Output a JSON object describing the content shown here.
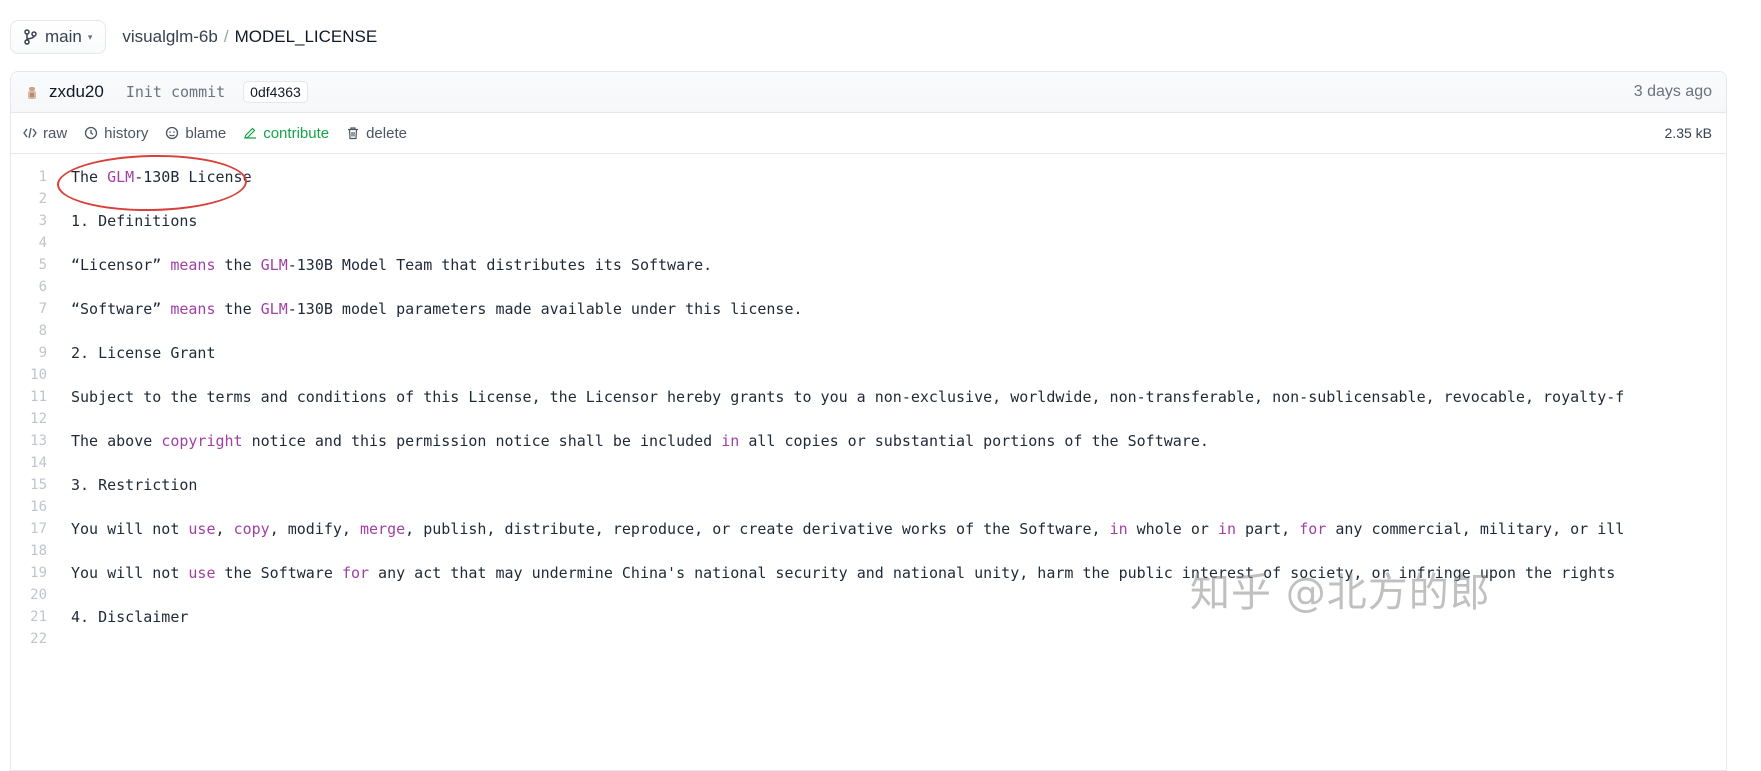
{
  "topbar": {
    "branch": "main",
    "repo": "visualglm-6b",
    "separator": "/",
    "file": "MODEL_LICENSE"
  },
  "commit": {
    "author": "zxdu20",
    "message": "Init commit",
    "sha": "0df4363",
    "time": "3 days ago"
  },
  "actions": {
    "raw": "raw",
    "history": "history",
    "blame": "blame",
    "contribute": "contribute",
    "delete": "delete",
    "size": "2.35 kB"
  },
  "colors": {
    "keyword": "#a23fa3",
    "contribute": "#16a34a",
    "annotation_circle": "#d9403a"
  },
  "lines": [
    {
      "n": "1",
      "parts": [
        {
          "t": "The "
        },
        {
          "t": "GLM",
          "k": true
        },
        {
          "t": "-130B License"
        }
      ]
    },
    {
      "n": "2",
      "parts": []
    },
    {
      "n": "3",
      "parts": [
        {
          "t": "1. Definitions"
        }
      ]
    },
    {
      "n": "4",
      "parts": []
    },
    {
      "n": "5",
      "parts": [
        {
          "t": "“Licensor” "
        },
        {
          "t": "means",
          "k": true
        },
        {
          "t": " the "
        },
        {
          "t": "GLM",
          "k": true
        },
        {
          "t": "-130B Model Team that distributes its Software."
        }
      ]
    },
    {
      "n": "6",
      "parts": []
    },
    {
      "n": "7",
      "parts": [
        {
          "t": "“Software” "
        },
        {
          "t": "means",
          "k": true
        },
        {
          "t": " the "
        },
        {
          "t": "GLM",
          "k": true
        },
        {
          "t": "-130B model parameters made available under this license."
        }
      ]
    },
    {
      "n": "8",
      "parts": []
    },
    {
      "n": "9",
      "parts": [
        {
          "t": "2. License Grant"
        }
      ]
    },
    {
      "n": "10",
      "parts": []
    },
    {
      "n": "11",
      "parts": [
        {
          "t": "Subject to the terms and conditions of this License, the Licensor hereby grants to you a non-exclusive, worldwide, non-transferable, non-sublicensable, revocable, royalty-f"
        }
      ]
    },
    {
      "n": "12",
      "parts": []
    },
    {
      "n": "13",
      "parts": [
        {
          "t": "The above "
        },
        {
          "t": "copyright",
          "k": true
        },
        {
          "t": " notice and this permission notice shall be included "
        },
        {
          "t": "in",
          "k": true
        },
        {
          "t": " all copies or substantial portions of the Software."
        }
      ]
    },
    {
      "n": "14",
      "parts": []
    },
    {
      "n": "15",
      "parts": [
        {
          "t": "3. Restriction"
        }
      ]
    },
    {
      "n": "16",
      "parts": []
    },
    {
      "n": "17",
      "parts": [
        {
          "t": "You will not "
        },
        {
          "t": "use",
          "k": true
        },
        {
          "t": ", "
        },
        {
          "t": "copy",
          "k": true
        },
        {
          "t": ", modify, "
        },
        {
          "t": "merge",
          "k": true
        },
        {
          "t": ", publish, distribute, reproduce, or create derivative works of the Software, "
        },
        {
          "t": "in",
          "k": true
        },
        {
          "t": " whole or "
        },
        {
          "t": "in",
          "k": true
        },
        {
          "t": " part, "
        },
        {
          "t": "for",
          "k": true
        },
        {
          "t": " any commercial, military, or ill"
        }
      ]
    },
    {
      "n": "18",
      "parts": []
    },
    {
      "n": "19",
      "parts": [
        {
          "t": "You will not "
        },
        {
          "t": "use",
          "k": true
        },
        {
          "t": " the Software "
        },
        {
          "t": "for",
          "k": true
        },
        {
          "t": " any act that may undermine China's national security and national unity, harm the public interest of society, or infringe upon the rights"
        }
      ]
    },
    {
      "n": "20",
      "parts": []
    },
    {
      "n": "21",
      "parts": [
        {
          "t": "4. Disclaimer"
        }
      ]
    },
    {
      "n": "22",
      "parts": []
    }
  ],
  "watermark": "知乎 @北方的郎"
}
